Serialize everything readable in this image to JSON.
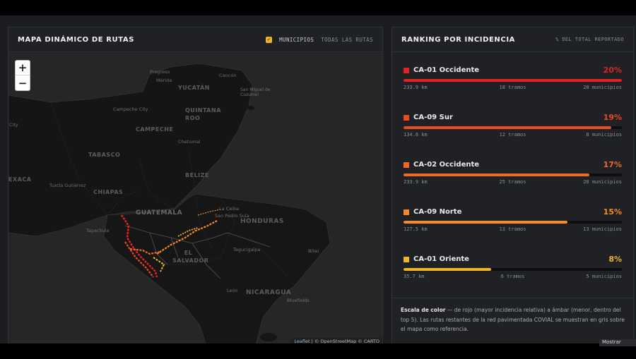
{
  "map_panel": {
    "title": "MAPA DINÁMICO DE RUTAS",
    "checkbox_label": "MUNICIPIOS",
    "all_routes_label": "TODAS LAS RUTAS",
    "zoom_in": "+",
    "zoom_out": "−",
    "attribution_leaflet": "Leaflet",
    "attribution_rest": "| © OpenStreetMap © CARTO",
    "place_labels": [
      "Progreso",
      "Mérida",
      "Cancún",
      "YUCATÁN",
      "San Miguel de Cozumel",
      "Campeche City",
      "QUINTANA ROO",
      "CAMPECHE",
      "City",
      "Chetumal",
      "TABASCO",
      "BELIZE",
      "Tuxtla Gutiérrez",
      "CHIAPAS",
      "EXACA",
      "GUATEMALA",
      "La Ceiba",
      "San Pedro Sula",
      "HONDURAS",
      "Tapachula",
      "EL SALVADOR",
      "Tegucigalpa",
      "Bilwi",
      "León",
      "NICARAGUA",
      "Bluefields"
    ]
  },
  "ranking_panel": {
    "title": "RANKING POR INCIDENCIA",
    "subtitle": "% DEL TOTAL REPORTADO",
    "items": [
      {
        "name": "CA-01 Occidente",
        "pct": "20%",
        "fill": 1.0,
        "km": "233.9 km",
        "tramos": "18 tramos",
        "municipios": "28 municipios",
        "color": "#e02424"
      },
      {
        "name": "CA-09 Sur",
        "pct": "19%",
        "fill": 0.95,
        "km": "134.8 km",
        "tramos": "12 tramos",
        "municipios": "8 municipios",
        "color": "#ec4a22"
      },
      {
        "name": "CA-02 Occidente",
        "pct": "17%",
        "fill": 0.85,
        "km": "233.9 km",
        "tramos": "25 tramos",
        "municipios": "28 municipios",
        "color": "#f06a26"
      },
      {
        "name": "CA-09 Norte",
        "pct": "15%",
        "fill": 0.75,
        "km": "127.5 km",
        "tramos": "13 tramos",
        "municipios": "13 municipios",
        "color": "#f58a26"
      },
      {
        "name": "CA-01 Oriente",
        "pct": "8%",
        "fill": 0.4,
        "km": "35.7 km",
        "tramos": "6 tramos",
        "municipios": "5 municipios",
        "color": "#f0b429"
      }
    ],
    "legend_title": "Escala de color",
    "legend_text": " — de rojo (mayor incidencia relativa) a ámbar (menor, dentro del top 5). Las rutas restantes de la red pavimentada COVIAL se muestran en gris sobre el mapa como referencia."
  },
  "tooltip_text": "Mostrar",
  "colors": {
    "background": "#1b1d20",
    "panel": "#1f2124",
    "accent": "#f0b429"
  }
}
